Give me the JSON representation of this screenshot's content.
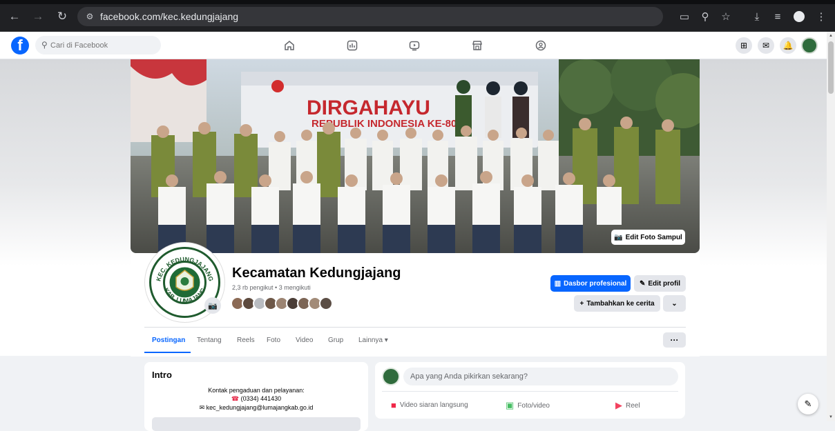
{
  "browser": {
    "back_icon": "arrow-left-icon",
    "forward_icon": "arrow-right-icon",
    "reload_icon": "reload-icon",
    "url": "facebook.com/kec.kedungjajang"
  },
  "facebook": {
    "search_placeholder": "Cari di Facebook",
    "brand_color": "#0866ff"
  },
  "cover": {
    "edit_label": "Edit Foto Sampul",
    "banner_title": "DIRGAHAYU",
    "banner_subtitle": "REPUBLIK INDONESIA KE-80"
  },
  "profile": {
    "name": "Kecamatan Kedungjajang",
    "stats": "2,3 rb pengikut • 3 mengikuti",
    "logo_text_top": "KEC. KEDUNGJAJANG",
    "logo_text_bottom": "KAB. LUMAJANG",
    "dashboard_label": "Dasbor profesional",
    "edit_profile_label": "Edit profil",
    "add_story_label": "Tambahkan ke cerita"
  },
  "tabs": [
    {
      "label": "Postingan",
      "active": true
    },
    {
      "label": "Tentang"
    },
    {
      "label": "Reels"
    },
    {
      "label": "Foto"
    },
    {
      "label": "Video"
    },
    {
      "label": "Grup"
    },
    {
      "label": "Lainnya ▾"
    }
  ],
  "intro": {
    "title": "Intro",
    "line1": "Kontak pengaduan dan pelayanan:",
    "phone": "(0334) 441430",
    "email": "kec_kedungjajang@lumajangkab.go.id"
  },
  "composer": {
    "placeholder": "Apa yang Anda pikirkan sekarang?",
    "live_label": "Video siaran langsung",
    "photo_label": "Foto/video",
    "reel_label": "Reel"
  }
}
